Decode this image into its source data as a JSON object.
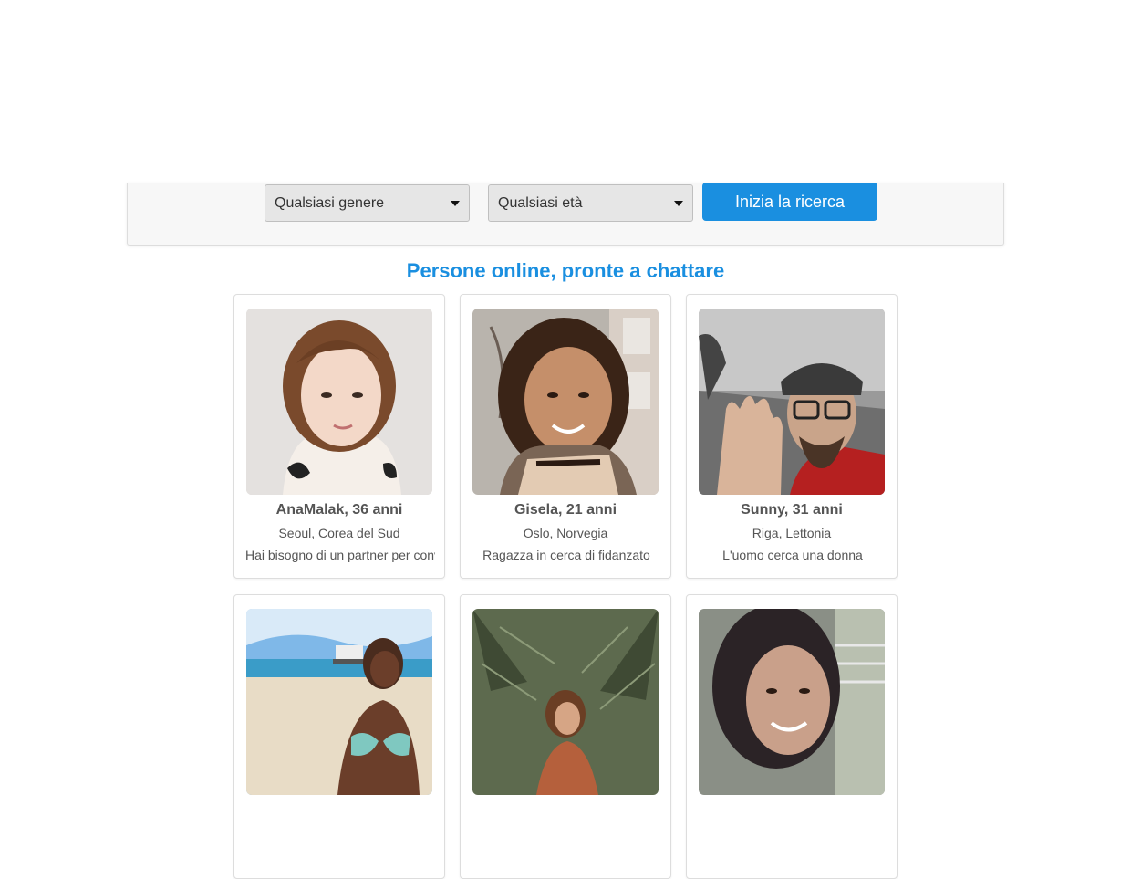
{
  "search": {
    "gender_selected": "Qualsiasi genere",
    "age_selected": "Qualsiasi età",
    "button_label": "Inizia la ricerca"
  },
  "section": {
    "title": "Persone online, pronte a chattare"
  },
  "profiles": [
    {
      "name": "AnaMalak, 36 anni",
      "location": "Seoul, Corea del Sud",
      "description": "Hai bisogno di un partner per conversare"
    },
    {
      "name": "Gisela, 21 anni",
      "location": "Oslo, Norvegia",
      "description": "Ragazza in cerca di fidanzato"
    },
    {
      "name": "Sunny, 31 anni",
      "location": "Riga, Lettonia",
      "description": "L'uomo cerca una donna"
    },
    {
      "name": "",
      "location": "",
      "description": ""
    },
    {
      "name": "",
      "location": "",
      "description": ""
    },
    {
      "name": "",
      "location": "",
      "description": ""
    }
  ],
  "icons": {
    "dropdown": "caret-down-icon"
  },
  "colors": {
    "accent": "#1a8fe0",
    "panel_bg": "#f7f7f7",
    "select_bg": "#e6e6e6"
  }
}
